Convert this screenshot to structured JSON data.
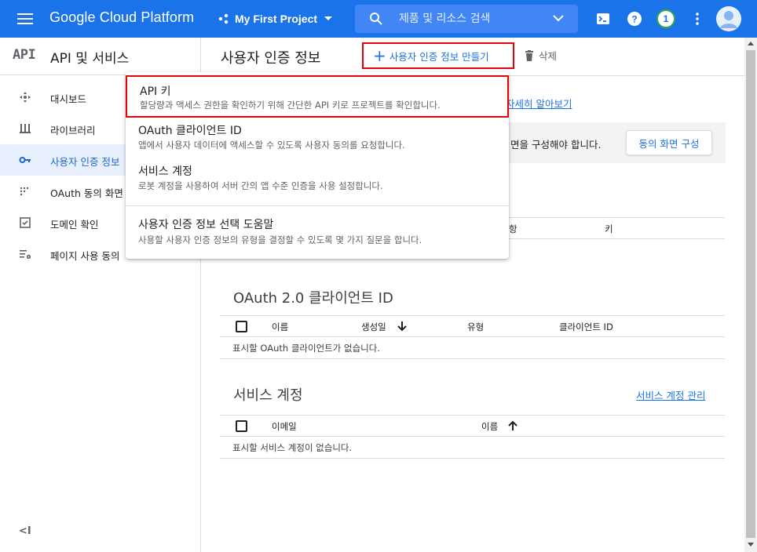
{
  "topbar": {
    "brand": "Google Cloud Platform",
    "project_name": "My First Project",
    "search_placeholder": "제품 및 리소스 검색",
    "notification_count": "1"
  },
  "sidebar": {
    "logo": "API",
    "title": "API 및 서비스",
    "items": [
      {
        "label": "대시보드",
        "icon": "dashboard-icon"
      },
      {
        "label": "라이브러리",
        "icon": "library-icon"
      },
      {
        "label": "사용자 인증 정보",
        "icon": "key-icon",
        "active": true
      },
      {
        "label": "OAuth 동의 화면",
        "icon": "consent-icon"
      },
      {
        "label": "도메인 확인",
        "icon": "domain-check-icon"
      },
      {
        "label": "페이지 사용 동의",
        "icon": "page-settings-icon"
      }
    ],
    "collapse_label": "<I"
  },
  "header": {
    "title": "사용자 인증 정보",
    "create_label": "사용자 인증 정보 만들기",
    "delete_label": "삭제"
  },
  "main": {
    "learn_more": "자세히 알아보기",
    "consent_banner_text": "면을 구성해야 합니다.",
    "consent_button": "동의 화면 구성",
    "api_keys_table": {
      "col_name": "항",
      "col_key": "키"
    },
    "oauth": {
      "title": "OAuth 2.0 클라이언트 ID",
      "columns": [
        "이름",
        "생성일",
        "유형",
        "클라이언트 ID"
      ],
      "empty": "표시할 OAuth 클라이언트가 없습니다."
    },
    "service_accounts": {
      "title": "서비스 계정",
      "manage_link": "서비스 계정 관리",
      "columns": [
        "이메일",
        "이름"
      ],
      "empty": "표시할 서비스 계정이 없습니다."
    }
  },
  "dropdown": {
    "items": [
      {
        "title": "API 키",
        "desc": "할당량과 액세스 권한을 확인하기 위해 간단한 API 키로 프로젝트를 확인합니다."
      },
      {
        "title": "OAuth 클라이언트 ID",
        "desc": "앱에서 사용자 데이터에 액세스할 수 있도록 사용자 동의를 요청합니다."
      },
      {
        "title": "서비스 계정",
        "desc": "로봇 계정을 사용하여 서버 간의 앱 수준 인증을 사용 설정합니다."
      },
      {
        "title": "사용자 인증 정보 선택 도움말",
        "desc": "사용할 사용자 인증 정보의 유형을 결정할 수 있도록 몇 가지 질문을 합니다."
      }
    ]
  },
  "colors": {
    "topbar": "#1a73e8",
    "highlight": "#e8000b",
    "link": "#1a73e8",
    "active_bg": "#e8f0fe"
  }
}
